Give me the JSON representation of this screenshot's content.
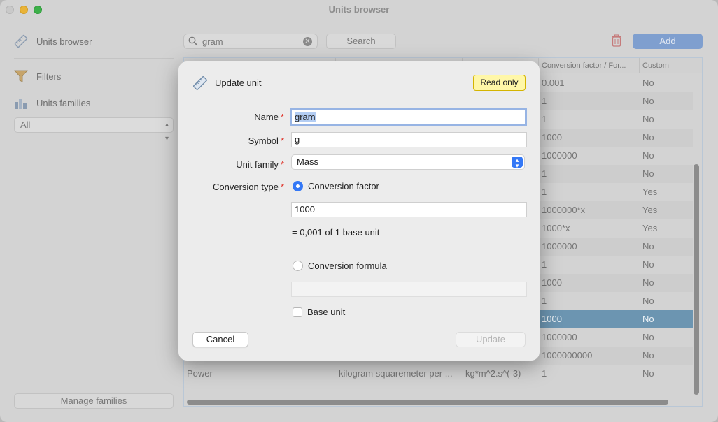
{
  "window": {
    "title": "Units browser"
  },
  "sidebar": {
    "browser_label": "Units browser",
    "filters_label": "Filters",
    "families_label": "Units families",
    "family_filter_value": "All",
    "manage_button": "Manage families"
  },
  "toolbar": {
    "search_value": "gram",
    "search_button": "Search",
    "add_button": "Add"
  },
  "table": {
    "headers": [
      "",
      "",
      "",
      "Conversion factor / For...",
      "Custom"
    ],
    "rows": [
      [
        "",
        "",
        "",
        "0.001",
        "No"
      ],
      [
        "",
        "",
        "",
        "1",
        "No"
      ],
      [
        "",
        "",
        "",
        "1",
        "No"
      ],
      [
        "",
        "",
        "",
        "1000",
        "No"
      ],
      [
        "",
        "",
        "",
        "1000000",
        "No"
      ],
      [
        "",
        "",
        "",
        "1",
        "No"
      ],
      [
        "",
        "",
        "",
        "1",
        "Yes"
      ],
      [
        "",
        "",
        "",
        "1000000*x",
        "Yes"
      ],
      [
        "",
        "",
        "",
        "1000*x",
        "Yes"
      ],
      [
        "",
        "",
        "",
        "1000000",
        "No"
      ],
      [
        "",
        "",
        "",
        "1",
        "No"
      ],
      [
        "",
        "",
        "",
        "1000",
        "No"
      ],
      [
        "",
        "",
        "",
        "1",
        "No"
      ],
      [
        "",
        "",
        "",
        "1000",
        "No"
      ],
      [
        "",
        "",
        "",
        "1000000",
        "No"
      ],
      [
        "",
        "",
        "",
        "1000000000",
        "No"
      ],
      [
        "Power",
        "kilogram squaremeter per ...",
        "kg*m^2.s^(-3)",
        "1",
        "No"
      ]
    ],
    "selected_row": 13
  },
  "dialog": {
    "title": "Update unit",
    "badge": "Read only",
    "name_label": "Name",
    "name_value": "gram",
    "symbol_label": "Symbol",
    "symbol_value": "g",
    "family_label": "Unit family",
    "family_value": "Mass",
    "conversion_type_label": "Conversion type",
    "factor_option": "Conversion factor",
    "factor_value": "1000",
    "factor_helper": "= 0,001 of 1 base unit",
    "formula_option": "Conversion formula",
    "formula_value": "",
    "base_unit_label": "Base unit",
    "cancel_button": "Cancel",
    "update_button": "Update",
    "required_mark": "*"
  },
  "colors": {
    "accent": "#3478f6",
    "selected_row": "#6c95b1",
    "badge_bg": "#fff7a8",
    "required": "#e0342b"
  }
}
